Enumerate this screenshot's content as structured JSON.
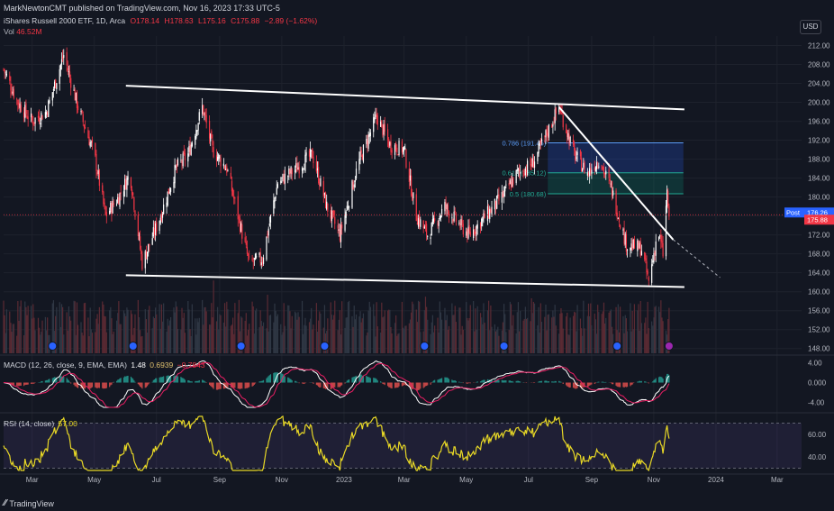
{
  "header": {
    "published": "MarkNewtonCMT published on TradingView.com, Nov 16, 2023 17:33 UTC-5"
  },
  "symbol": {
    "name": "iShares Russell 2000 ETF, 1D, Arca",
    "open": "O178.14",
    "high": "H178.63",
    "low": "L175.16",
    "close": "C175.88",
    "change": "−2.89 (−1.62%)"
  },
  "volume": {
    "label": "Vol",
    "value": "46.52M"
  },
  "currency": "USD",
  "macd": {
    "label": "MACD (12, 26, close, 9, EMA, EMA)",
    "v1": "1.48",
    "v2": "0.6939",
    "v3": "−0.7843"
  },
  "rsi": {
    "label": "RSI (14, close)",
    "value": "57.00"
  },
  "footer": {
    "brand": "TradingView"
  },
  "colors": {
    "bg": "#131722",
    "up": "#ffffff",
    "down": "#f23645",
    "accent": "#2962ff",
    "rsi": "#e8d826"
  },
  "chart_data": [
    {
      "type": "candlestick",
      "title": "iShares Russell 2000 ETF, 1D, Arca",
      "ylim": [
        147,
        214
      ],
      "y_ticks": [
        "212.00",
        "208.00",
        "204.00",
        "200.00",
        "196.00",
        "192.00",
        "188.00",
        "184.00",
        "180.00",
        "176.00",
        "172.00",
        "168.00",
        "164.00",
        "160.00",
        "156.00",
        "152.00",
        "148.00"
      ],
      "x_ticks": [
        "Mar",
        "May",
        "Jul",
        "Sep",
        "Nov",
        "2023",
        "Mar",
        "May",
        "Jul",
        "Sep",
        "Nov",
        "2024",
        "Mar"
      ],
      "price_path": [
        [
          "2022-02-01",
          207
        ],
        [
          "2022-02-15",
          200
        ],
        [
          "2022-03-01",
          196
        ],
        [
          "2022-03-15",
          198
        ],
        [
          "2022-04-01",
          210
        ],
        [
          "2022-04-15",
          199
        ],
        [
          "2022-05-01",
          189
        ],
        [
          "2022-05-12",
          176
        ],
        [
          "2022-05-25",
          180
        ],
        [
          "2022-06-05",
          185
        ],
        [
          "2022-06-17",
          166
        ],
        [
          "2022-07-05",
          176
        ],
        [
          "2022-07-20",
          186
        ],
        [
          "2022-08-01",
          189
        ],
        [
          "2022-08-15",
          199
        ],
        [
          "2022-08-25",
          190
        ],
        [
          "2022-09-08",
          186
        ],
        [
          "2022-09-30",
          166
        ],
        [
          "2022-10-13",
          167
        ],
        [
          "2022-10-28",
          183
        ],
        [
          "2022-11-15",
          186
        ],
        [
          "2022-12-01",
          189
        ],
        [
          "2022-12-15",
          178
        ],
        [
          "2022-12-28",
          172
        ],
        [
          "2023-01-15",
          187
        ],
        [
          "2023-02-02",
          197
        ],
        [
          "2023-02-15",
          191
        ],
        [
          "2023-03-01",
          190
        ],
        [
          "2023-03-13",
          176
        ],
        [
          "2023-03-24",
          172
        ],
        [
          "2023-04-10",
          178
        ],
        [
          "2023-04-25",
          174
        ],
        [
          "2023-05-04",
          172
        ],
        [
          "2023-05-20",
          176
        ],
        [
          "2023-06-05",
          180
        ],
        [
          "2023-06-20",
          185
        ],
        [
          "2023-07-05",
          187
        ],
        [
          "2023-07-31",
          199
        ],
        [
          "2023-08-15",
          189
        ],
        [
          "2023-08-28",
          185
        ],
        [
          "2023-09-08",
          188
        ],
        [
          "2023-09-20",
          182
        ],
        [
          "2023-10-05",
          170
        ],
        [
          "2023-10-20",
          169
        ],
        [
          "2023-10-27",
          162
        ],
        [
          "2023-11-05",
          173
        ],
        [
          "2023-11-10",
          168
        ],
        [
          "2023-11-14",
          181
        ],
        [
          "2023-11-16",
          175.88
        ]
      ],
      "last_price_labels": [
        {
          "text": "Post",
          "value": "176.26"
        },
        {
          "text": "",
          "value": "175.88"
        }
      ],
      "fib_levels": [
        {
          "label": "0.786 (191.45)",
          "value": 191.45
        },
        {
          "label": "0.618 (185.12)",
          "value": 185.12
        },
        {
          "label": "0.5 (180.68)",
          "value": 180.68
        }
      ],
      "trendlines": [
        {
          "name": "upper channel",
          "from": [
            "2022-06-01",
            203.5
          ],
          "to": [
            "2023-12-01",
            198.5
          ]
        },
        {
          "name": "lower channel",
          "from": [
            "2022-06-01",
            163.5
          ],
          "to": [
            "2023-12-01",
            161.0
          ]
        },
        {
          "name": "downtrend",
          "from": [
            "2023-07-31",
            199
          ],
          "to": [
            "2023-11-20",
            171
          ]
        }
      ]
    },
    {
      "type": "bar",
      "title": "Vol",
      "value_label": "46.52M"
    },
    {
      "type": "line",
      "title": "MACD (12, 26, close, 9, EMA, EMA)",
      "ylim": [
        -5,
        5
      ],
      "y_ticks": [
        "4.00",
        "0.000",
        "-4.00"
      ]
    },
    {
      "type": "line",
      "title": "RSI (14, close)",
      "ylim": [
        28,
        76
      ],
      "y_ticks": [
        "60.00",
        "40.00"
      ],
      "bands": [
        70,
        30
      ],
      "last": 57.0
    }
  ]
}
